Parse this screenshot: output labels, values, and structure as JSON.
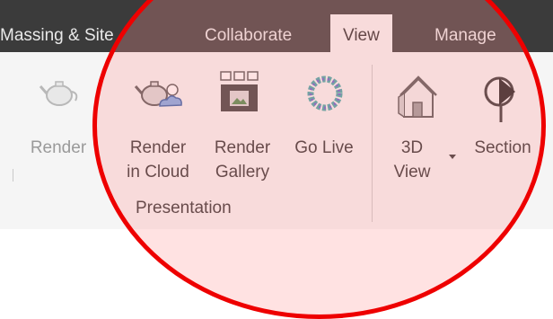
{
  "tabs": [
    {
      "label": "Massing & Site"
    },
    {
      "label": "Collaborate"
    },
    {
      "label": "View"
    },
    {
      "label": "Manage"
    }
  ],
  "ribbon": {
    "render": {
      "label": "Render"
    },
    "render_cloud": {
      "line1": "Render",
      "line2": "in Cloud"
    },
    "render_gallery": {
      "line1": "Render",
      "line2": "Gallery"
    },
    "go_live": {
      "label": "Go Live"
    },
    "view_3d": {
      "line1": "3D",
      "line2": "View"
    },
    "section": {
      "label": "Section"
    },
    "panel_label": "Presentation"
  },
  "colors": {
    "tab_bar": "#3b3b3b",
    "ribbon_bg": "#f5f5f5",
    "highlight_circle": "#ee0000"
  }
}
